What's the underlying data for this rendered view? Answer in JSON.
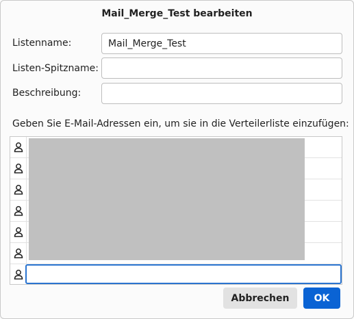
{
  "dialog": {
    "title": "Mail_Merge_Test bearbeiten"
  },
  "form": {
    "listname_label": "Listenname:",
    "listname_value": "Mail_Merge_Test",
    "nickname_label": "Listen-Spitzname:",
    "nickname_value": "",
    "description_label": "Beschreibung:",
    "description_value": ""
  },
  "members": {
    "instruction": "Geben Sie E-Mail-Adressen ein, um sie in die Verteilerliste einzufügen:",
    "row_icon": "person-icon",
    "new_address_value": ""
  },
  "buttons": {
    "cancel_label": "Abbrechen",
    "ok_label": "OK",
    "ok_color": "#0a63d4"
  }
}
